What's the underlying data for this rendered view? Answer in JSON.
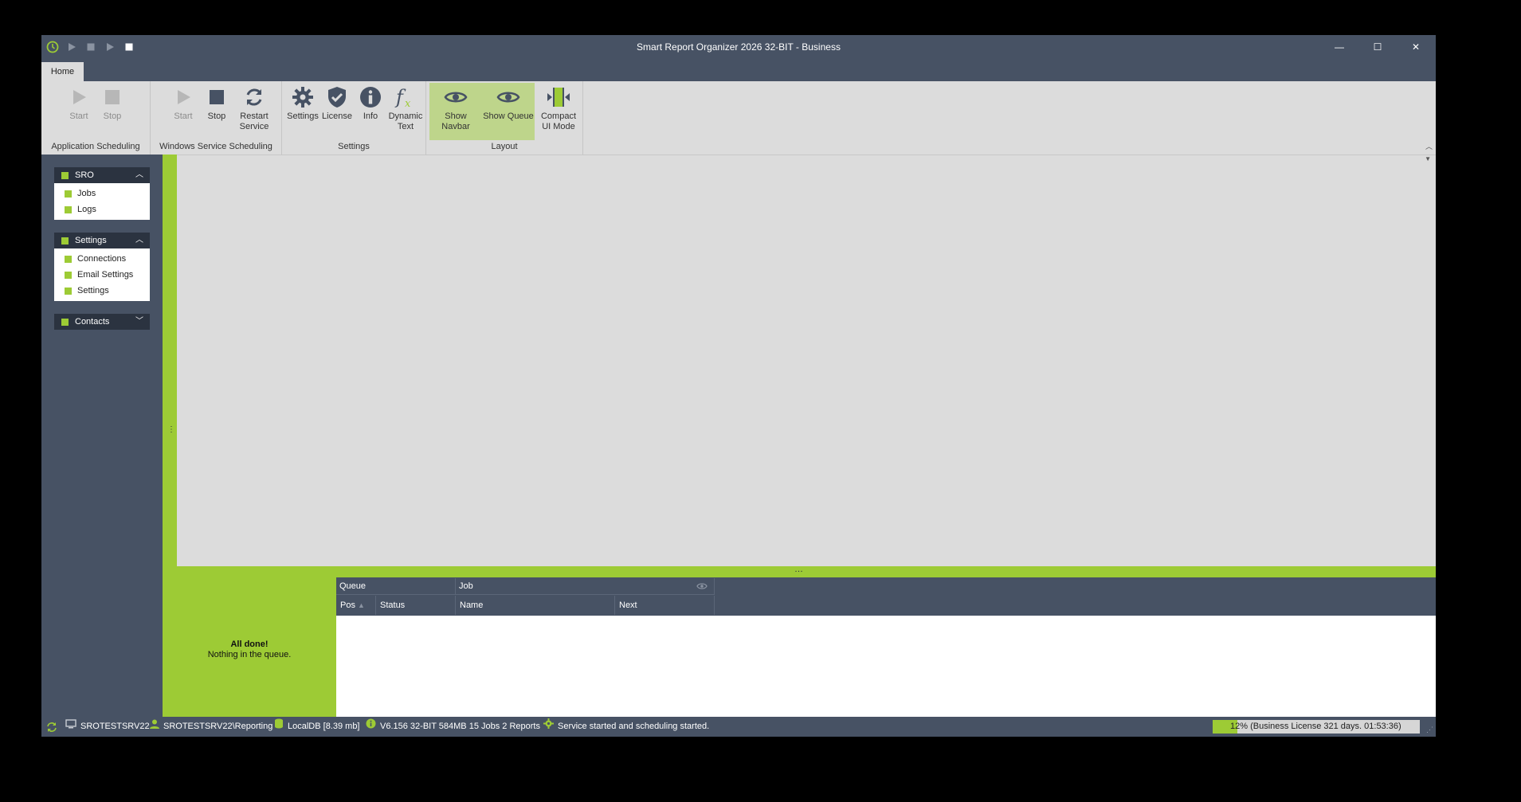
{
  "window": {
    "title": "Smart Report Organizer 2026 32-BIT - Business",
    "controls": {
      "minimize": "—",
      "maximize": "☐",
      "close": "✕"
    }
  },
  "tabs": [
    {
      "label": "Home",
      "active": true
    }
  ],
  "ribbon": {
    "groups": [
      {
        "label": "Application Scheduling",
        "buttons": [
          {
            "label": "Start",
            "icon": "play-icon",
            "enabled": false
          },
          {
            "label": "Stop",
            "icon": "stop-icon",
            "enabled": false
          }
        ]
      },
      {
        "label": "Windows Service Scheduling",
        "buttons": [
          {
            "label": "Start",
            "icon": "play-icon",
            "enabled": false
          },
          {
            "label": "Stop",
            "icon": "stop-icon",
            "enabled": true
          },
          {
            "label": "Restart Service",
            "icon": "refresh-icon",
            "enabled": true
          }
        ]
      },
      {
        "label": "Settings",
        "buttons": [
          {
            "label": "Settings",
            "icon": "gear-icon",
            "enabled": true
          },
          {
            "label": "License",
            "icon": "shield-check-icon",
            "enabled": true
          },
          {
            "label": "Info",
            "icon": "info-icon",
            "enabled": true
          },
          {
            "label": "Dynamic Text",
            "icon": "function-icon",
            "enabled": true
          }
        ]
      },
      {
        "label": "Layout",
        "buttons": [
          {
            "label": "Show Navbar",
            "icon": "eye-icon",
            "checked": true
          },
          {
            "label": "Show Queue",
            "icon": "eye-icon",
            "checked": true
          },
          {
            "label": "Compact UI Mode",
            "icon": "compact-icon",
            "checked": false
          }
        ]
      }
    ]
  },
  "navbar": {
    "groups": [
      {
        "title": "SRO",
        "expanded": true,
        "items": [
          "Jobs",
          "Logs"
        ]
      },
      {
        "title": "Settings",
        "expanded": true,
        "items": [
          "Connections",
          "Email Settings",
          "Settings"
        ]
      },
      {
        "title": "Contacts",
        "expanded": false,
        "items": []
      }
    ]
  },
  "queue": {
    "empty_title": "All done!",
    "empty_subtitle": "Nothing in the queue.",
    "bands": [
      "Queue",
      "Job"
    ],
    "columns": [
      "Pos",
      "Status",
      "Name",
      "Next"
    ]
  },
  "statusbar": {
    "computer": "SROTESTSRV22",
    "user": "SROTESTSRV22\\Reporting",
    "database": "LocalDB [8.39 mb]",
    "version": "V6.156 32-BIT 584MB 15 Jobs 2 Reports",
    "service": "Service started and scheduling started.",
    "license_text": "12% (Business License 321 days. 01:53:36)",
    "license_progress": 0.12
  },
  "colors": {
    "accent": "#9dcb35",
    "frame": "#475264",
    "dark": "#2b3340",
    "ribbon": "#dcdcdc"
  }
}
